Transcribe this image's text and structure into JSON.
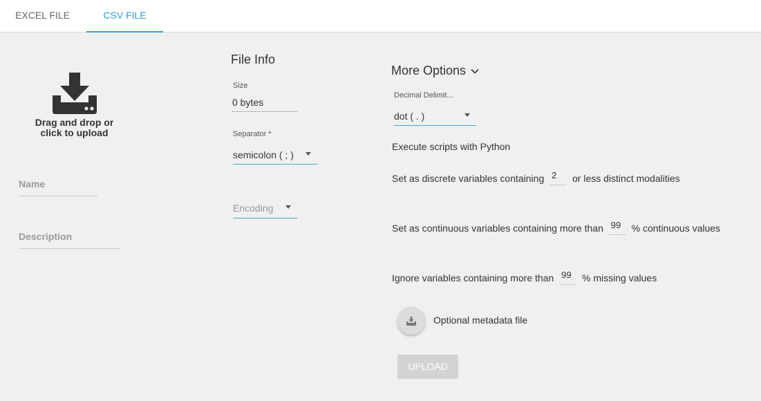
{
  "tabs": [
    {
      "label": "EXCEL FILE"
    },
    {
      "label": "CSV FILE"
    }
  ],
  "dropzone": {
    "text": "Drag and drop or click to upload",
    "icon": "download-icon"
  },
  "name_field": {
    "label": "Name"
  },
  "description_field": {
    "label": "Description"
  },
  "file_info": {
    "title": "File Info",
    "size_label": "Size",
    "size_value": "0 bytes",
    "separator_label": "Separator *",
    "separator_value": "semicolon ( ; )",
    "encoding_placeholder": "Encoding"
  },
  "more_options": {
    "title": "More Options",
    "decimal_label": "Decimal Delimit...",
    "decimal_value": "dot ( . )",
    "python_text": "Execute scripts with Python",
    "discrete_pre": "Set as discrete variables containing",
    "discrete_value": "2",
    "discrete_post": "or less distinct modalities",
    "continuous_pre": "Set as continuous variables containing more than",
    "continuous_value": "99",
    "continuous_post": "% continuous values",
    "missing_pre": "Ignore variables containing more than",
    "missing_value": "99",
    "missing_post": "% missing values",
    "metadata_text": "Optional metadata file",
    "upload_label": "UPLOAD"
  },
  "colors": {
    "accent": "#2a9fd8",
    "background": "#f0f0f0"
  }
}
